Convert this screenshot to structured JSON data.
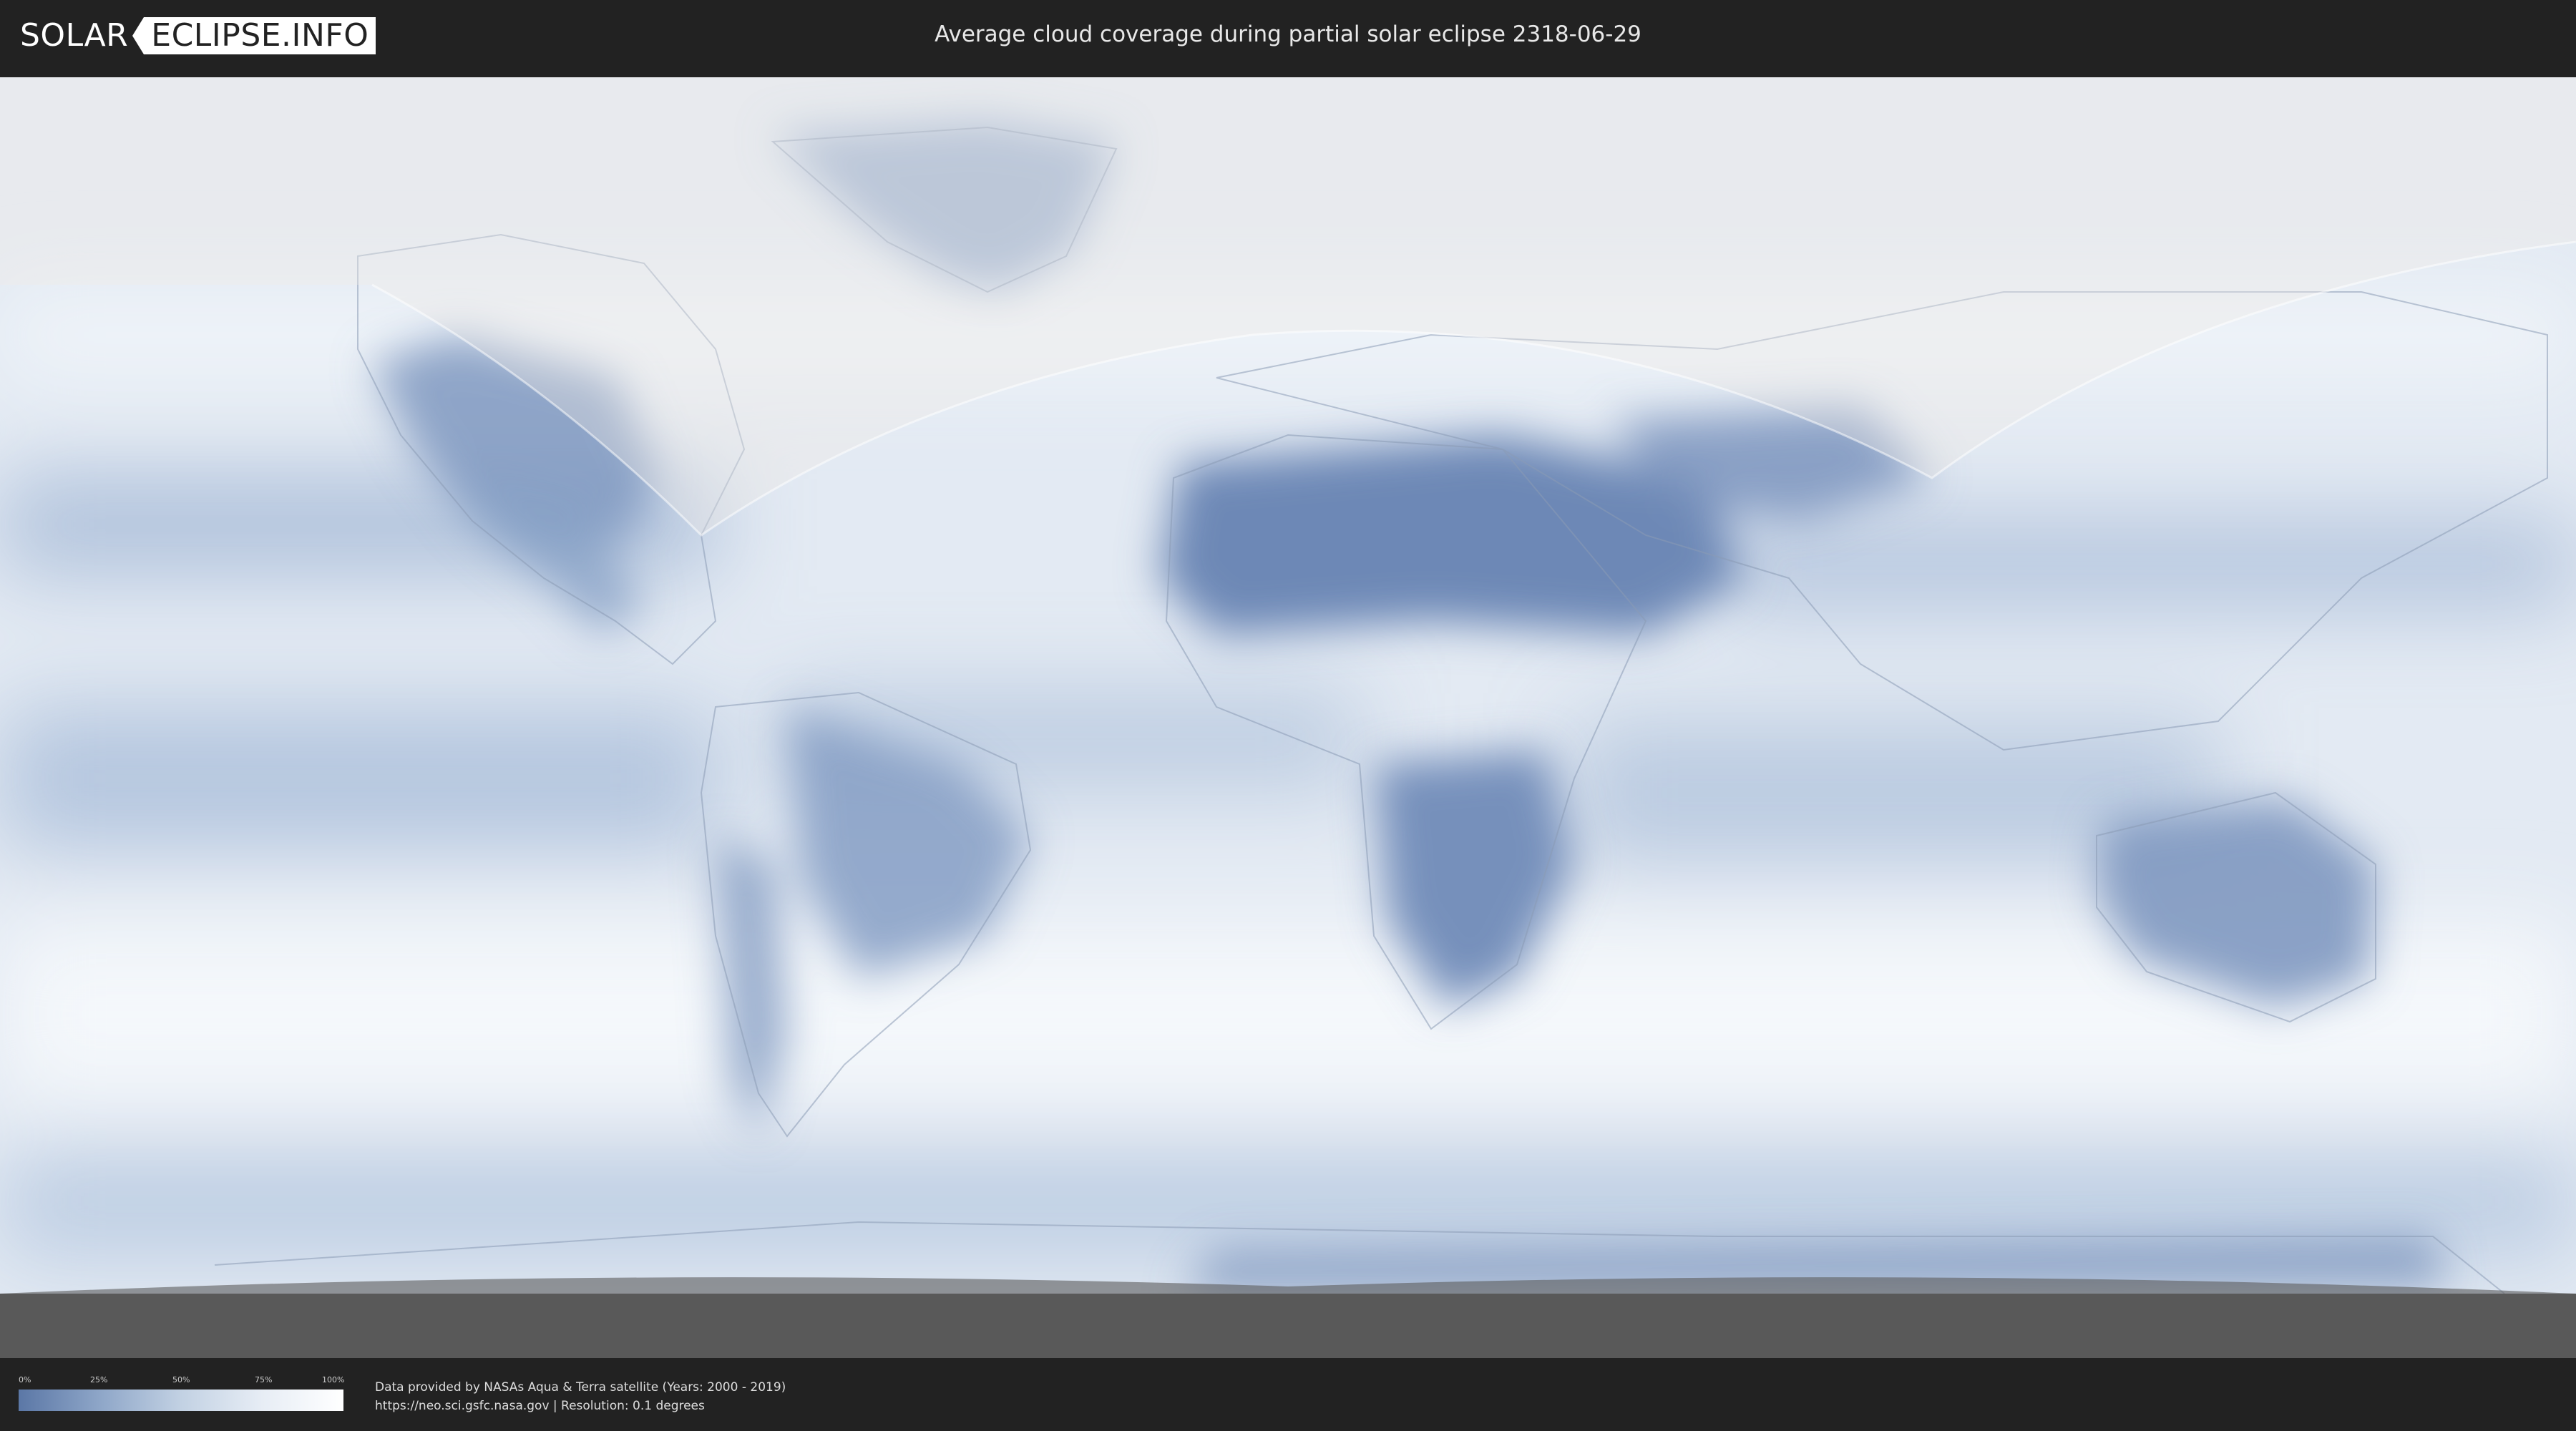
{
  "header": {
    "logo_part1": "SOLAR",
    "logo_part2": "ECLIPSE.INFO",
    "title": "Average cloud coverage during partial solar eclipse 2318-06-29"
  },
  "legend": {
    "ticks": [
      "0%",
      "25%",
      "50%",
      "75%",
      "100%"
    ],
    "colors": [
      "#5b77a6",
      "#8ea6c8",
      "#c2d1e3",
      "#e7edf5",
      "#ffffff"
    ]
  },
  "footer": {
    "credit_line1": "Data provided by NASAs Aqua & Terra satellite (Years: 2000 - 2019)",
    "credit_line2": "https://neo.sci.gsfc.nasa.gov | Resolution: 0.1 degrees"
  },
  "map": {
    "cloud_color_clear": "#5b77a6",
    "cloud_color_overcast": "#ffffff",
    "polar_night_color": "#555555"
  }
}
